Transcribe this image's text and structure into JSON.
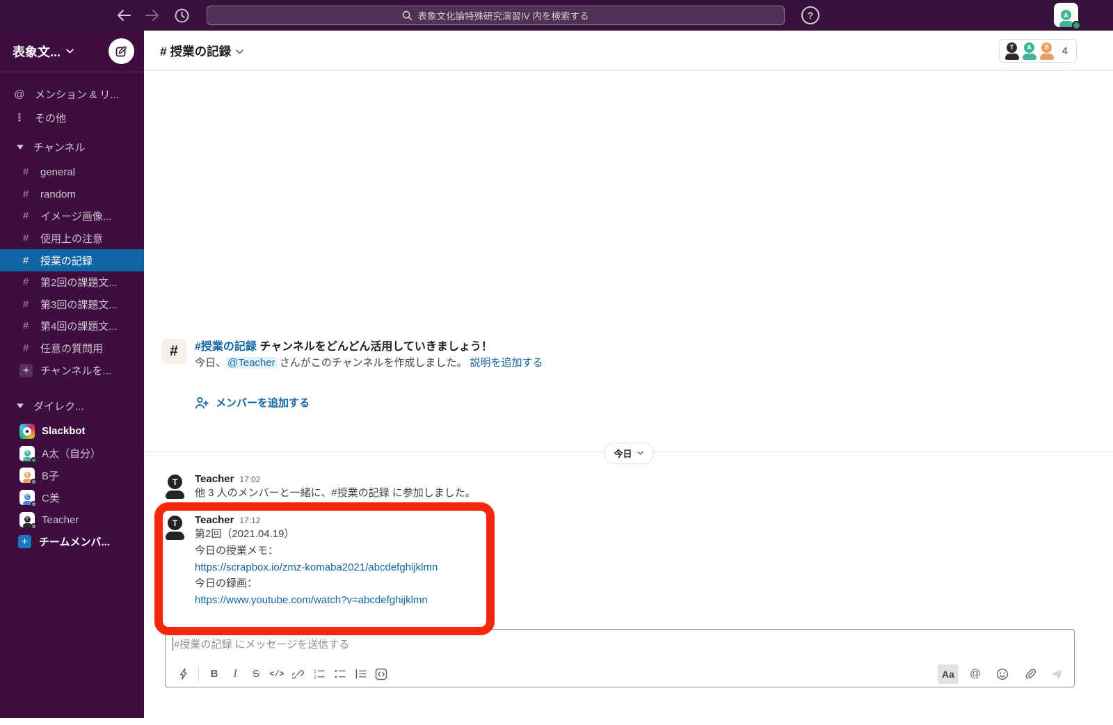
{
  "topbar": {
    "search_placeholder": "表象文化論特殊研究演習IV 内を検索する",
    "help_label": "?",
    "user_avatar_letter": "A"
  },
  "sidebar": {
    "workspace_name": "表象文...",
    "mentions_label": "メンション & リ...",
    "mentions_icon": "@",
    "more_label": "その他",
    "more_icon": "⋮",
    "channels_section_label": "チャンネル",
    "channels": [
      {
        "label": "general"
      },
      {
        "label": "random"
      },
      {
        "label": "イメージ画像..."
      },
      {
        "label": "使用上の注意"
      },
      {
        "label": "授業の記録",
        "selected": true
      },
      {
        "label": "第2回の課題文..."
      },
      {
        "label": "第3回の課題文..."
      },
      {
        "label": "第4回の課題文..."
      },
      {
        "label": "任意の質問用"
      }
    ],
    "hash": "#",
    "plus": "+",
    "add_channel_label": "チャンネルを...",
    "dm_section_label": "ダイレク...",
    "dms": [
      {
        "name": "Slackbot",
        "avatar": "slackbot"
      },
      {
        "name": "A太（自分）",
        "avatar_letter": "A",
        "status": "online",
        "color": "#40b39a"
      },
      {
        "name": "B子",
        "avatar_letter": "B",
        "status": "offline",
        "color": "#eb9d60"
      },
      {
        "name": "C美",
        "avatar_letter": "C",
        "status": "offline",
        "color": "#4a86d8"
      },
      {
        "name": "Teacher",
        "avatar_letter": "T",
        "status": "offline",
        "color": "#2b2b2b"
      }
    ],
    "add_member_label": "チームメンバ..."
  },
  "header": {
    "channel_title": "# 授業の記録",
    "member_count": "4",
    "member_avatars": [
      {
        "letter": "T",
        "color": "#2b2b2b"
      },
      {
        "letter": "A",
        "color": "#40b39a"
      },
      {
        "letter": "B",
        "color": "#eb9d60"
      }
    ]
  },
  "intro": {
    "hash": "#",
    "title_channel": "#授業の記録",
    "title_rest": " チャンネルをどんどん活用していきましょう！",
    "desc_pre": "今日、",
    "mention": "@Teacher",
    "desc_post": " さんがこのチャンネルを作成しました。 ",
    "add_desc_link": "説明を追加する",
    "add_member_link": "メンバーを追加する"
  },
  "date_divider_label": "今日",
  "messages": [
    {
      "author": "Teacher",
      "time": "17:02",
      "avatar_letter": "T",
      "line": "他 3 人のメンバーと一緒に、#授業の記録 に参加しました。"
    },
    {
      "author": "Teacher",
      "time": "17:12",
      "avatar_letter": "T",
      "line0": "第2回（2021.04.19）",
      "line1": "今日の授業メモ：",
      "link1": "https://scrapbox.io/zmz-komaba2021/abcdefghijklmn",
      "line2": "今日の録画：",
      "link2": "https://www.youtube.com/watch?v=abcdefghijklmn"
    }
  ],
  "composer": {
    "placeholder": "#授業の記録 にメッセージを送信する",
    "bold_label": "B",
    "italic_label": "I",
    "strike_label": "S",
    "code_label": "</>",
    "format_toggle_label": "Aa",
    "mention_label": "@"
  },
  "colors": {
    "sidebar_bg": "#3F0E40",
    "topbar_bg": "#38123C",
    "selected_channel_bg": "#1164A3",
    "link_blue": "#1264A3",
    "annotation_red": "#F4270C",
    "online_green": "#2EA664"
  }
}
